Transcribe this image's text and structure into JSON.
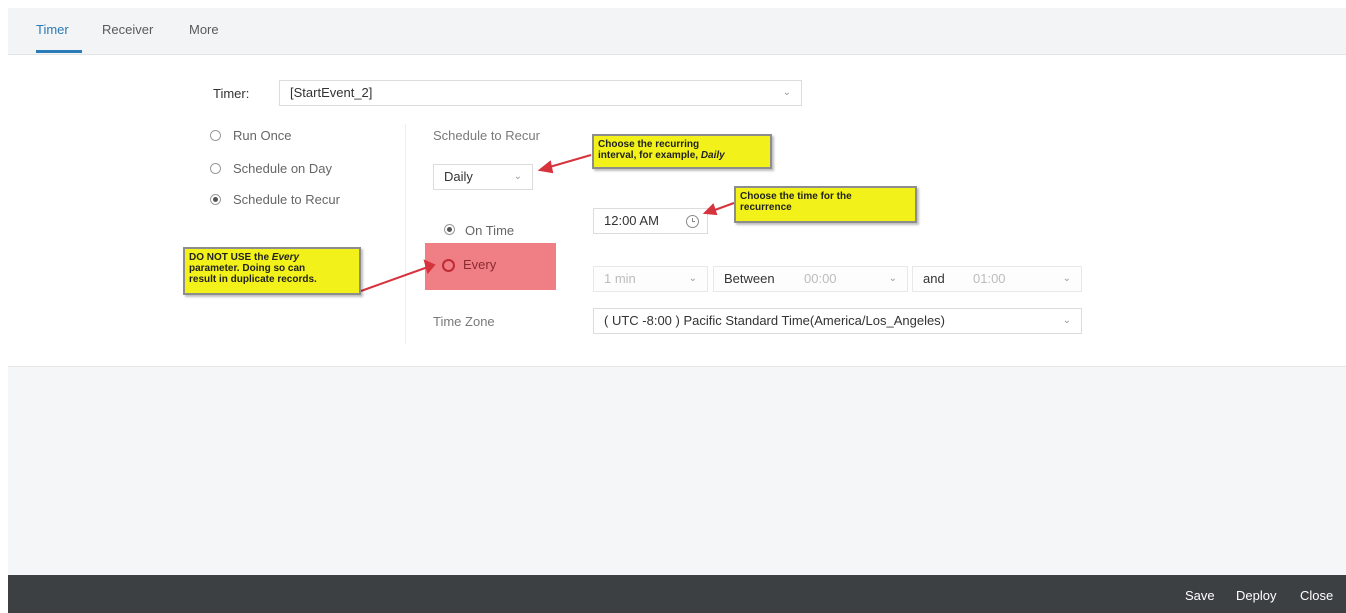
{
  "tabs": [
    {
      "label": "Timer",
      "active": true
    },
    {
      "label": "Receiver",
      "active": false
    },
    {
      "label": "More",
      "active": false
    }
  ],
  "timer": {
    "label": "Timer:",
    "value": "[StartEvent_2]"
  },
  "schedule_options": [
    {
      "label": "Run Once",
      "selected": false
    },
    {
      "label": "Schedule on Day",
      "selected": false
    },
    {
      "label": "Schedule to Recur",
      "selected": true
    }
  ],
  "recur": {
    "heading": "Schedule to Recur",
    "interval": "Daily",
    "on_time_label": "On Time",
    "time_value": "12:00 AM",
    "every_label": "Every",
    "every_interval": "1 min",
    "between_label": "Between",
    "between_value": "00:00",
    "and_label": "and",
    "and_value": "01:00",
    "timezone_label": "Time Zone",
    "timezone_value": "( UTC -8:00 ) Pacific Standard Time(America/Los_Angeles)"
  },
  "callouts": {
    "interval_line1": "Choose the recurring",
    "interval_line2_prefix": "interval, for example, ",
    "interval_line2_em": "Daily",
    "time_line1": "Choose the time for the",
    "time_line2": "recurrence",
    "warn_line1_prefix": "DO NOT USE the ",
    "warn_line1_em": "Every",
    "warn_line2": "parameter. Doing so can",
    "warn_line3": "result in duplicate records."
  },
  "footer": {
    "save": "Save",
    "deploy": "Deploy",
    "close": "Close"
  },
  "colors": {
    "accent": "#2a7bb6",
    "callout": "#f2f21a",
    "highlight": "#f07f85",
    "arrow": "#d6333d",
    "footer": "#3c4043"
  }
}
